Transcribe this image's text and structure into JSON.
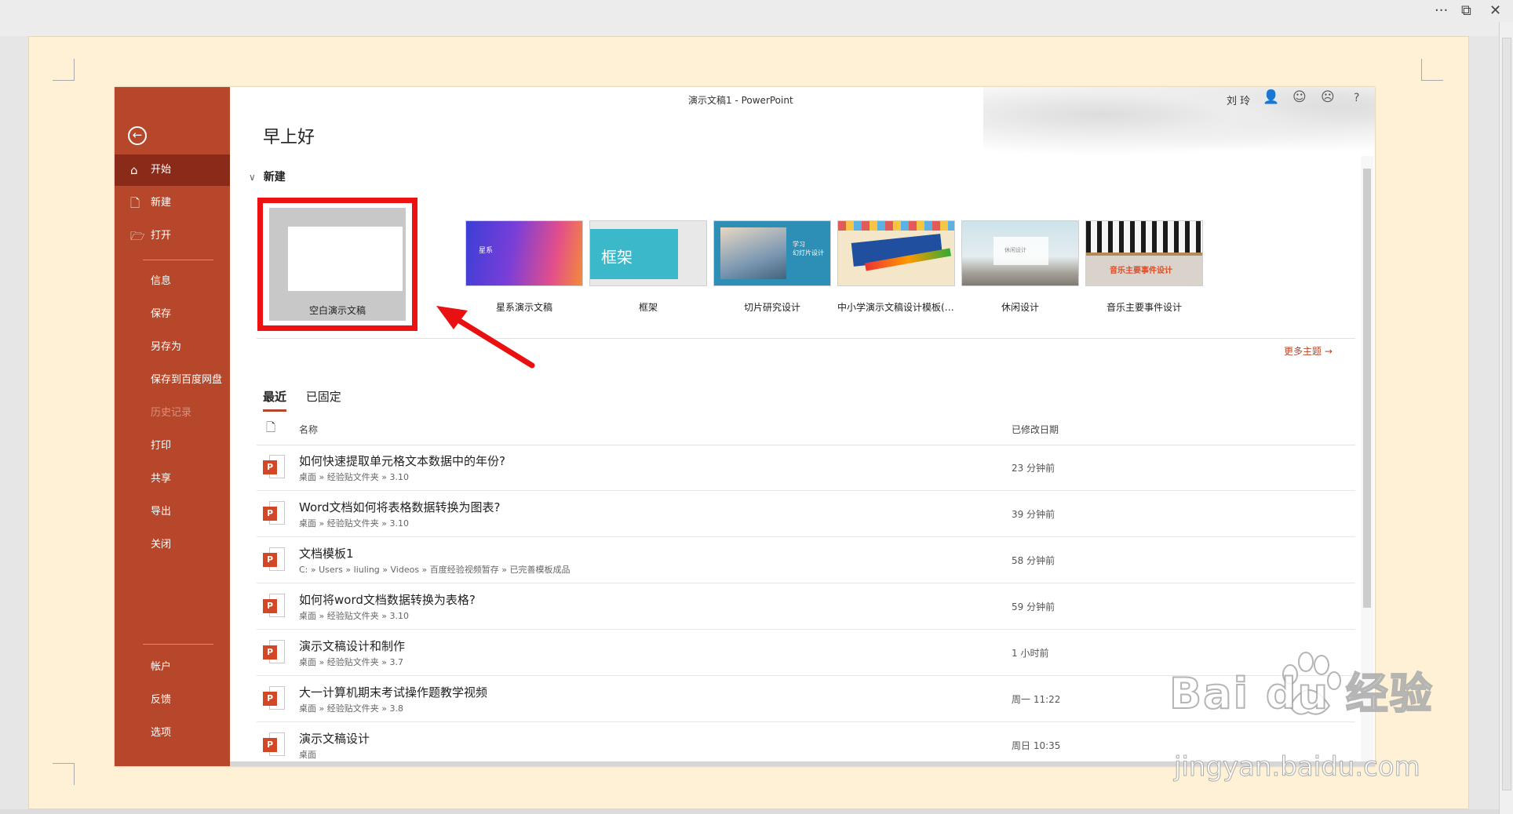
{
  "outer": {
    "more_icon": "ellipsis-icon",
    "restore_icon": "restore-icon",
    "close_icon": "close-icon"
  },
  "window": {
    "title": "演示文稿1  -  PowerPoint",
    "user": "刘 玲",
    "help": "?"
  },
  "greeting": "早上好",
  "sidebar": {
    "items": [
      {
        "label": "开始",
        "icon": "home-icon"
      },
      {
        "label": "新建",
        "icon": "new-file-icon"
      },
      {
        "label": "打开",
        "icon": "open-folder-icon"
      },
      {
        "label": "信息"
      },
      {
        "label": "保存"
      },
      {
        "label": "另存为"
      },
      {
        "label": "保存到百度网盘"
      },
      {
        "label": "历史记录"
      },
      {
        "label": "打印"
      },
      {
        "label": "共享"
      },
      {
        "label": "导出"
      },
      {
        "label": "关闭"
      },
      {
        "label": "帐户"
      },
      {
        "label": "反馈"
      },
      {
        "label": "选项"
      }
    ]
  },
  "new_section": {
    "title": "新建",
    "templates": [
      {
        "name": "空白演示文稿"
      },
      {
        "name": "星系演示文稿",
        "thumb_text": "星系"
      },
      {
        "name": "框架",
        "thumb_text": "框架"
      },
      {
        "name": "切片研究设计",
        "thumb_text": "学习\n幻灯片设计"
      },
      {
        "name": "中小学演示文稿设计模板(竞..."
      },
      {
        "name": "休闲设计",
        "thumb_text": "休闲设计"
      },
      {
        "name": "音乐主要事件设计",
        "thumb_text": "音乐主要事件设计"
      }
    ],
    "more_themes": "更多主题 →"
  },
  "recent": {
    "tabs": [
      "最近",
      "已固定"
    ],
    "col_name": "名称",
    "col_date": "已修改日期",
    "files": [
      {
        "name": "如何快速提取单元格文本数据中的年份?",
        "path": "桌面 » 经验贴文件夹 » 3.10",
        "date": "23 分钟前"
      },
      {
        "name": "Word文档如何将表格数据转换为图表?",
        "path": "桌面 » 经验贴文件夹 » 3.10",
        "date": "39 分钟前"
      },
      {
        "name": "文档模板1",
        "path": "C: » Users » liuling » Videos » 百度经验视频暂存 » 已完善模板成品",
        "date": "58 分钟前"
      },
      {
        "name": "如何将word文档数据转换为表格?",
        "path": "桌面 » 经验贴文件夹 » 3.10",
        "date": "59 分钟前"
      },
      {
        "name": "演示文稿设计和制作",
        "path": "桌面 » 经验贴文件夹 » 3.7",
        "date": "1 小时前"
      },
      {
        "name": "大一计算机期末考试操作题教学视频",
        "path": "桌面 » 经验贴文件夹 » 3.8",
        "date": "周一 11:22"
      },
      {
        "name": "演示文稿设计",
        "path": "桌面",
        "date": "周日 10:35"
      }
    ]
  },
  "watermark": {
    "brand": "Bai du 经验",
    "url": "jingyan.baidu.com"
  },
  "colors": {
    "sidebar": "#b7472a",
    "highlight_box": "#ee1111",
    "arrow": "#e81010"
  }
}
